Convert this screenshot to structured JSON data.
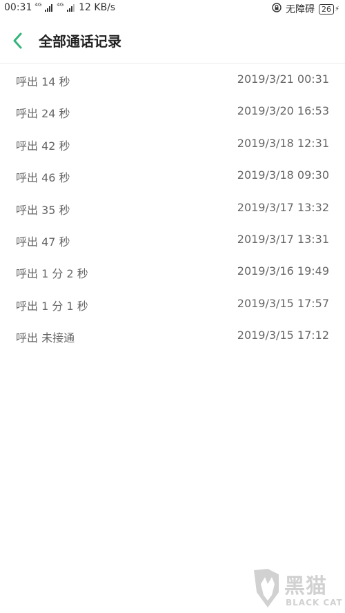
{
  "status_bar": {
    "time": "00:31",
    "sim1_network": "4G",
    "sim2_network": "4G",
    "speed": "12 KB/s",
    "accessibility_label": "无障碍",
    "battery_level": "26",
    "charging": true
  },
  "header": {
    "title": "全部通话记录",
    "accent_color": "#34b37a"
  },
  "calls": [
    {
      "type": "呼出",
      "duration": "14 秒",
      "datetime": "2019/3/21 00:31"
    },
    {
      "type": "呼出",
      "duration": "24 秒",
      "datetime": "2019/3/20 16:53"
    },
    {
      "type": "呼出",
      "duration": "42 秒",
      "datetime": "2019/3/18 12:31"
    },
    {
      "type": "呼出",
      "duration": "46 秒",
      "datetime": "2019/3/18 09:30"
    },
    {
      "type": "呼出",
      "duration": "35 秒",
      "datetime": "2019/3/17 13:32"
    },
    {
      "type": "呼出",
      "duration": "47 秒",
      "datetime": "2019/3/17 13:31"
    },
    {
      "type": "呼出",
      "duration": "1 分 2 秒",
      "datetime": "2019/3/16 19:49"
    },
    {
      "type": "呼出",
      "duration": "1 分 1 秒",
      "datetime": "2019/3/15 17:57"
    },
    {
      "type": "呼出",
      "duration": "未接通",
      "datetime": "2019/3/15 17:12"
    }
  ],
  "watermark": {
    "logo_text": "黑猫",
    "sub_text": "BLACK CAT"
  }
}
